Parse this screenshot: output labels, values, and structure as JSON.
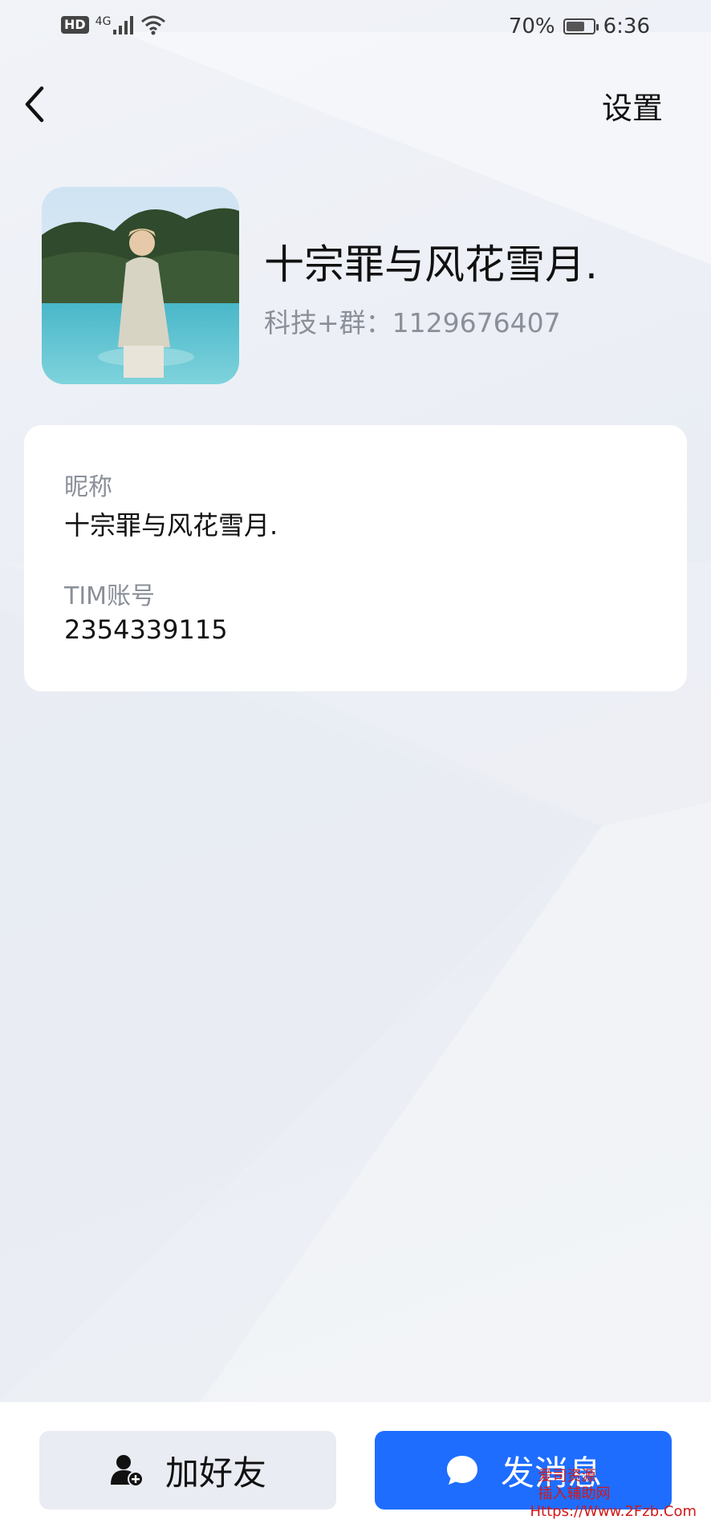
{
  "status_bar": {
    "hd": "HD",
    "network": "4G",
    "battery": "70%",
    "battery_level": 0.7,
    "time": "6:36"
  },
  "header": {
    "back_icon": "chevron-left-icon",
    "settings_label": "设置"
  },
  "profile": {
    "name": "十宗罪与风花雪月.",
    "signature": "科技+群：1129676407"
  },
  "info": {
    "nickname_label": "昵称",
    "nickname_value": "十宗罪与风花雪月.",
    "account_label": "TIM账号",
    "account_value": "2354339115"
  },
  "actions": {
    "add_friend_label": "加好友",
    "add_friend_icon": "add-user-icon",
    "send_message_label": "发消息",
    "send_message_icon": "chat-bubble-icon"
  },
  "colors": {
    "accent": "#1e6dff",
    "secondary_text": "#8a8f99"
  },
  "watermark": {
    "line1": "爱司资源",
    "line2": "插入辅助网",
    "line3": "Https://Www.2Fzb.Com"
  }
}
